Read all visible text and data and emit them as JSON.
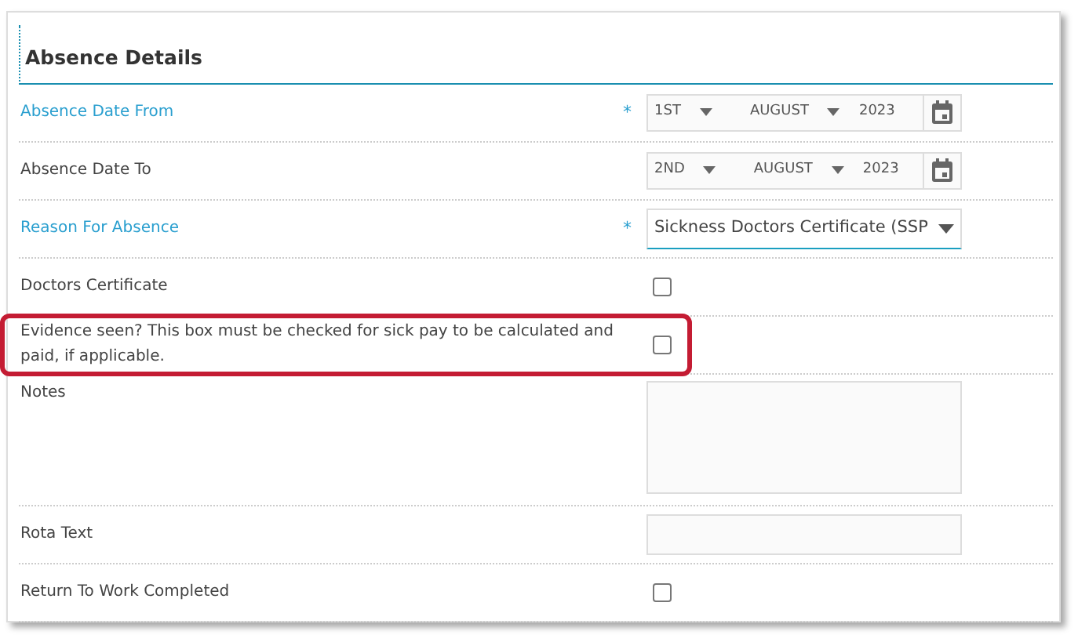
{
  "panel": {
    "title": "Absence Details"
  },
  "fields": [
    {
      "kind": "date",
      "label": "Absence Date From",
      "required_mark": "*",
      "day": "1ST",
      "month": "AUGUST",
      "year": "2023"
    },
    {
      "kind": "date",
      "label": "Absence Date To",
      "day": "2ND",
      "month": "AUGUST",
      "year": "2023"
    },
    {
      "kind": "select",
      "label": "Reason For Absence",
      "required_mark": "*",
      "value": "Sickness Doctors Certificate (SSP"
    },
    {
      "kind": "checkbox",
      "label": "Doctors Certificate",
      "checked": false
    },
    {
      "kind": "checkbox",
      "label": "Evidence seen? This box must be checked for sick pay to be calculated and paid, if applicable.",
      "highlighted": true,
      "checked": false
    },
    {
      "kind": "textarea",
      "label": "Notes"
    },
    {
      "kind": "text",
      "label": "Rota Text"
    },
    {
      "kind": "checkbox",
      "label": "Return To Work Completed",
      "checked": false
    }
  ]
}
